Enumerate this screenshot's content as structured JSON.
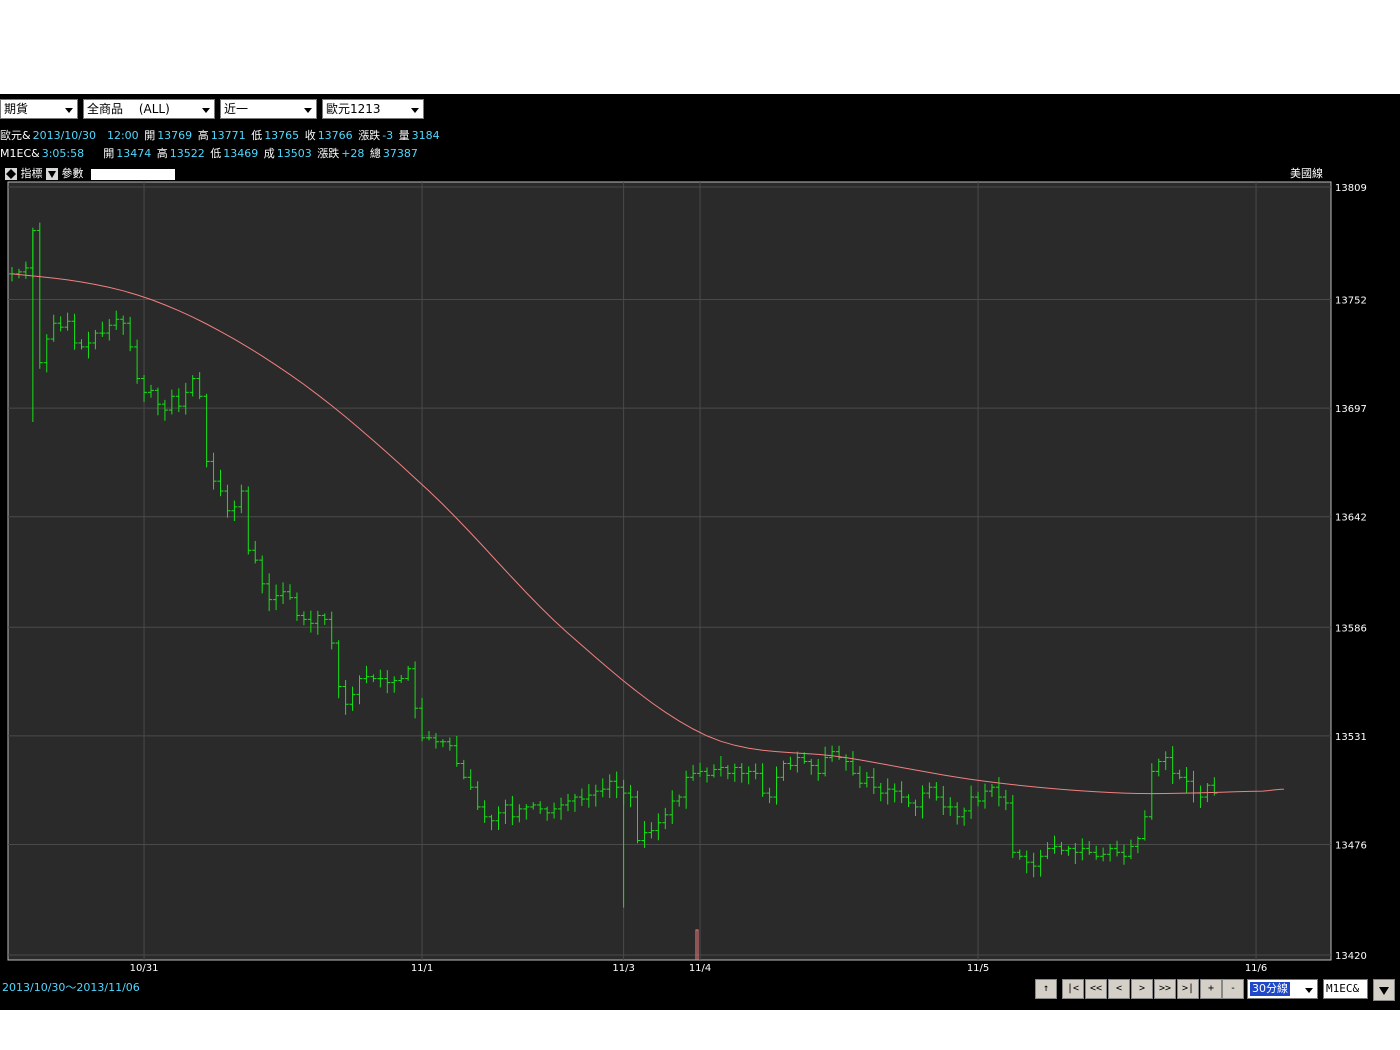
{
  "toolbar": {
    "selects": [
      {
        "label": "期貨"
      },
      {
        "label": "全商品　 (ALL)"
      },
      {
        "label": "近一"
      },
      {
        "label": "歐元1213"
      }
    ]
  },
  "info": {
    "row1": {
      "symbol": "歐元&",
      "datetime": "2013/10/30　12:00",
      "open_label": "開",
      "open": "13769",
      "high_label": "高",
      "high": "13771",
      "low_label": "低",
      "low": "13765",
      "close_label": "收",
      "close": "13766",
      "change_label": "漲跌",
      "change": "-3",
      "vol_label": "量",
      "vol": "3184"
    },
    "row2": {
      "symbol": "M1EC&",
      "time": "3:05:58",
      "open_label": "開",
      "open": "13474",
      "high_label": "高",
      "high": "13522",
      "low_label": "低",
      "low": "13469",
      "last_label": "成",
      "last": "13503",
      "change_label": "漲跌",
      "change": "+28",
      "total_label": "總",
      "total": "37387"
    }
  },
  "chart_toolbar": {
    "indicator_label": "指標",
    "param_label": "參數",
    "style_label": "美國線"
  },
  "colors": {
    "bars": "#18e018",
    "ma": "#f08080",
    "grid": "#4a4a4a",
    "panel": "#2a2a2a",
    "label": "#ffffff",
    "cyan": "#4fd9ff"
  },
  "footer": {
    "date_range": "2013/10/30～2013/11/06",
    "nav_buttons": [
      "↑",
      "|<",
      "<<",
      "<",
      ">",
      ">>",
      ">|",
      "+",
      "-"
    ],
    "period": "30分線",
    "symbol": "M1EC&"
  },
  "chart_data": {
    "type": "ohlc",
    "ylim": [
      13420,
      13809
    ],
    "y_ticks": [
      13809,
      13752,
      13697,
      13642,
      13586,
      13531,
      13476,
      13420
    ],
    "x_labels": [
      {
        "label": "10/31",
        "index": 19
      },
      {
        "label": "11/1",
        "index": 59
      },
      {
        "label": "11/3",
        "index": 88
      },
      {
        "label": "11/4",
        "index": 99
      },
      {
        "label": "11/5",
        "index": 139
      },
      {
        "label": "11/6",
        "index": 179
      }
    ],
    "closes": [
      13765,
      13766,
      13768,
      13787,
      13720,
      13732,
      13740,
      13738,
      13741,
      13730,
      13728,
      13730,
      13735,
      13735,
      13739,
      13742,
      13740,
      13728,
      13712,
      13705,
      13706,
      13699,
      13696,
      13703,
      13698,
      13705,
      13712,
      13703,
      13670,
      13660,
      13655,
      13645,
      13647,
      13655,
      13625,
      13620,
      13608,
      13600,
      13602,
      13604,
      13601,
      13592,
      13590,
      13588,
      13592,
      13590,
      13578,
      13556,
      13547,
      13552,
      13560,
      13561,
      13560,
      13560,
      13558,
      13559,
      13560,
      13565,
      13545,
      13530,
      13530,
      13528,
      13528,
      13526,
      13517,
      13510,
      13505,
      13495,
      13490,
      13488,
      13492,
      13496,
      13490,
      13494,
      13495,
      13496,
      13494,
      13492,
      13494,
      13496,
      13498,
      13500,
      13499,
      13501,
      13503,
      13504,
      13508,
      13505,
      13502,
      13500,
      13478,
      13482,
      13483,
      13487,
      13491,
      13498,
      13500,
      13510,
      13512,
      13513,
      13511,
      13514,
      13515,
      13512,
      13515,
      13512,
      13513,
      13512,
      13502,
      13500,
      13510,
      13517,
      13516,
      13520,
      13518,
      13516,
      13512,
      13520,
      13523,
      13520,
      13518,
      13512,
      13507,
      13510,
      13505,
      13502,
      13504,
      13503,
      13500,
      13497,
      13495,
      13502,
      13505,
      13500,
      13495,
      13495,
      13490,
      13493,
      13500,
      13498,
      13503,
      13505,
      13500,
      13497,
      13472,
      13470,
      13467,
      13465,
      13470,
      13474,
      13475,
      13473,
      13474,
      13472,
      13474,
      13472,
      13470,
      13471,
      13474,
      13472,
      13470,
      13475,
      13479,
      13490,
      13513,
      13518,
      13520,
      13512,
      13510,
      13508,
      13502,
      13500,
      13506,
      13502
    ],
    "ma": [
      {
        "index": 0,
        "value": 13765
      },
      {
        "index": 20,
        "value": 13752
      },
      {
        "index": 40,
        "value": 13714
      },
      {
        "index": 60,
        "value": 13655
      },
      {
        "index": 80,
        "value": 13583
      },
      {
        "index": 100,
        "value": 13531
      },
      {
        "index": 120,
        "value": 13520
      },
      {
        "index": 140,
        "value": 13508
      },
      {
        "index": 160,
        "value": 13502
      },
      {
        "index": 180,
        "value": 13503
      },
      {
        "index": 183,
        "value": 13504
      }
    ]
  }
}
